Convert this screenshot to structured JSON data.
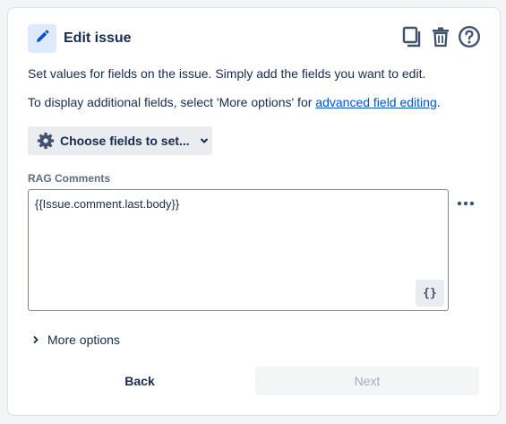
{
  "header": {
    "title": "Edit issue",
    "icons": [
      "pencil-icon",
      "copy-icon",
      "trash-icon",
      "help-icon"
    ]
  },
  "description": {
    "line1": "Set values for fields on the issue. Simply add the fields you want to edit.",
    "line2_prefix": "To display additional fields, select 'More options' for ",
    "line2_link": "advanced field editing",
    "line2_suffix": "."
  },
  "choose_fields": {
    "label": "Choose fields to set..."
  },
  "field": {
    "label": "RAG Comments",
    "value": "{{Issue.comment.last.body}}",
    "smart_value_button": "{}"
  },
  "more_options": {
    "label": "More options"
  },
  "footer": {
    "back_label": "Back",
    "next_label": "Next"
  },
  "colors": {
    "accent": "#0052cc",
    "badge_bg": "#deebff",
    "text": "#172b4d",
    "disabled_text": "#a5adba"
  }
}
